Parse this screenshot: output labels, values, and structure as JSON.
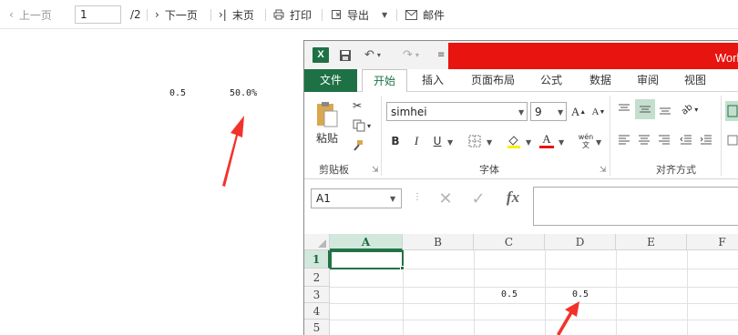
{
  "report_toolbar": {
    "prev_page": "上一页",
    "page_input_value": "1",
    "page_total": "/2",
    "next_page": "下一页",
    "last_page": "末页",
    "print": "打印",
    "export": "导出",
    "mail": "邮件"
  },
  "report_cells": {
    "value": "0.5",
    "percent": "50.0%"
  },
  "excel": {
    "title": "Work",
    "logo": "X",
    "tabs": [
      "文件",
      "开始",
      "插入",
      "页面布局",
      "公式",
      "数据",
      "审阅",
      "视图"
    ],
    "clipboard": {
      "paste_label": "粘贴",
      "group_label": "剪贴板"
    },
    "font": {
      "family": "simhei",
      "size": "9",
      "group_label": "字体",
      "bold": "B",
      "italic": "I",
      "underline": "U",
      "font_color": "A",
      "phonetic": "wén\n文"
    },
    "alignment": {
      "group_label": "对齐方式"
    },
    "name_box": "A1",
    "formula_cancel": "✕",
    "formula_enter": "✓",
    "formula_fx": "fx",
    "columns": [
      "A",
      "B",
      "C",
      "D",
      "E",
      "F"
    ],
    "rows": [
      "1",
      "2",
      "3",
      "4",
      "5"
    ],
    "cells": {
      "C3": "0.5",
      "D3": "0.5"
    }
  },
  "colors": {
    "excel_green": "#1e7145",
    "title_red": "#e8140f",
    "arrow_red": "#f2332b"
  }
}
